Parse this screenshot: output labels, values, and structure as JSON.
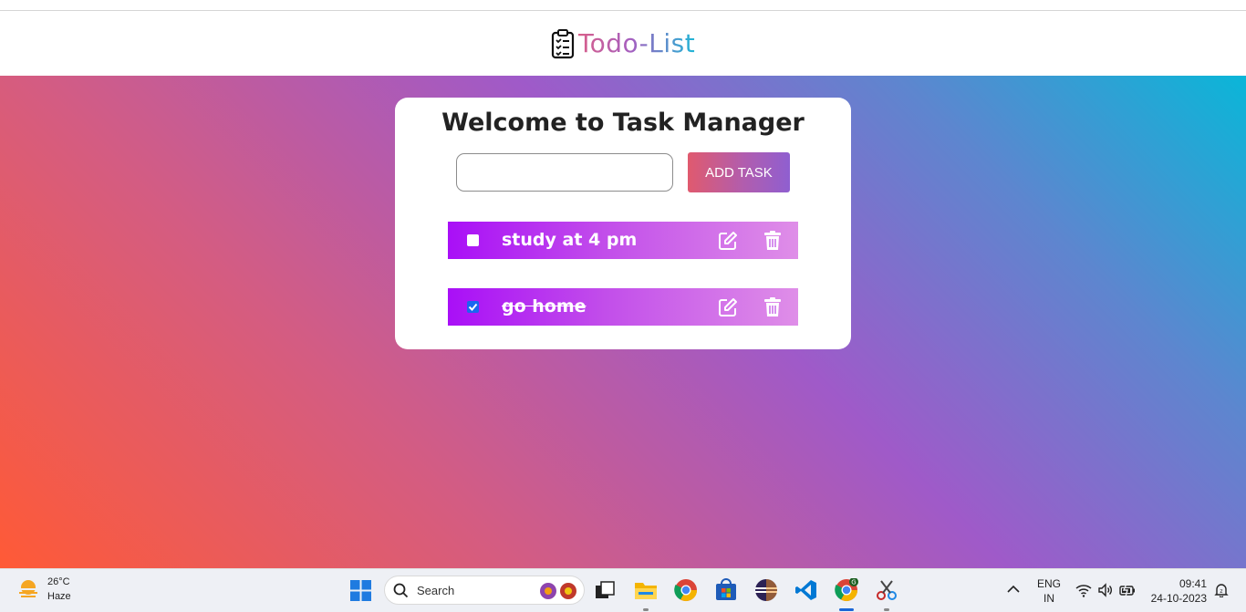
{
  "header": {
    "title": "Todo-List",
    "icon": "clipboard-list-icon"
  },
  "card": {
    "title": "Welcome to Task Manager",
    "input_value": "",
    "add_button_label": "ADD TASK"
  },
  "tasks": [
    {
      "text": "study at 4 pm",
      "completed": false
    },
    {
      "text": "go home",
      "completed": true
    }
  ],
  "taskbar": {
    "weather": {
      "temp": "26°C",
      "condition": "Haze"
    },
    "search_label": "Search",
    "apps": [
      "task-view-icon",
      "file-explorer-icon",
      "chrome-icon",
      "microsoft-store-icon",
      "eclipse-icon",
      "vscode-icon",
      "chrome-profile-icon",
      "snipping-tool-icon"
    ],
    "language": {
      "line1": "ENG",
      "line2": "IN"
    },
    "clock": {
      "time": "09:41",
      "date": "24-10-2023"
    }
  },
  "colors": {
    "gradient_start": "#ff5a36",
    "gradient_mid": "#9f5ac9",
    "gradient_end": "#0ab6d8",
    "task_bar_start": "#a90ff7",
    "task_bar_end": "#df8ee8",
    "checkbox_checked": "#1a66f0"
  }
}
